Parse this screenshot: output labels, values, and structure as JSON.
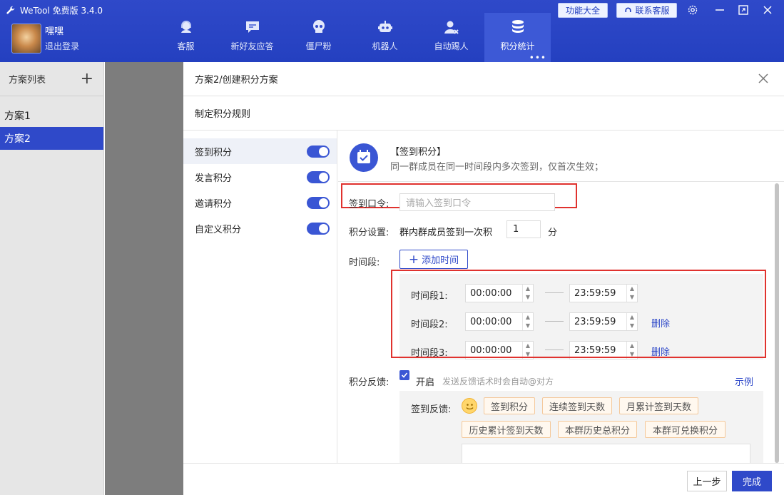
{
  "app": {
    "title": "WeTool 免费版 3.4.0",
    "func_btn": "功能大全",
    "contact_btn": "联系客服"
  },
  "user": {
    "name": "嘿嘿",
    "logout": "退出登录"
  },
  "nav": [
    {
      "label": "客服",
      "icon": "headset-icon"
    },
    {
      "label": "新好友应答",
      "icon": "chat-bubble-icon"
    },
    {
      "label": "僵尸粉",
      "icon": "skull-icon"
    },
    {
      "label": "机器人",
      "icon": "robot-icon"
    },
    {
      "label": "自动踢人",
      "icon": "user-remove-icon"
    },
    {
      "label": "积分统计",
      "icon": "database-icon",
      "active": true
    }
  ],
  "sidebar": {
    "title": "方案列表",
    "plans": [
      "方案1",
      "方案2"
    ],
    "active": 1
  },
  "dialog": {
    "title": "方案2/创建积分方案",
    "subtitle": "制定积分规则",
    "rules": [
      {
        "label": "签到积分",
        "enabled": true
      },
      {
        "label": "发言积分",
        "enabled": true
      },
      {
        "label": "邀请积分",
        "enabled": true
      },
      {
        "label": "自定义积分",
        "enabled": true
      }
    ],
    "section_title": "【签到积分】",
    "section_desc": "同一群成员在同一时间段内多次签到，仅首次生效；",
    "password_label": "签到口令:",
    "password_placeholder": "请输入签到口令",
    "score_label": "积分设置:",
    "score_text": "群内群成员签到一次积",
    "score_value": "1",
    "score_unit": "分",
    "period_label": "时间段:",
    "add_time": "添加时间",
    "periods": [
      {
        "label": "时间段1:",
        "start": "00:00:00",
        "end": "23:59:59",
        "delete": ""
      },
      {
        "label": "时间段2:",
        "start": "00:00:00",
        "end": "23:59:59",
        "delete": "删除"
      },
      {
        "label": "时间段3:",
        "start": "00:00:00",
        "end": "23:59:59",
        "delete": "删除"
      }
    ],
    "feedback_label": "积分反馈:",
    "feedback_on": "开启",
    "feedback_hint": "发送反馈话术时会自动@对方",
    "example": "示例",
    "checkin_feedback_label": "签到反馈:",
    "tags": [
      "签到积分",
      "连续签到天数",
      "月累计签到天数",
      "历史累计签到天数",
      "本群历史总积分",
      "本群可兑换积分"
    ],
    "prev": "上一步",
    "done": "完成"
  },
  "colors": {
    "primary": "#2f49c9",
    "highlight": "#e0322e"
  }
}
